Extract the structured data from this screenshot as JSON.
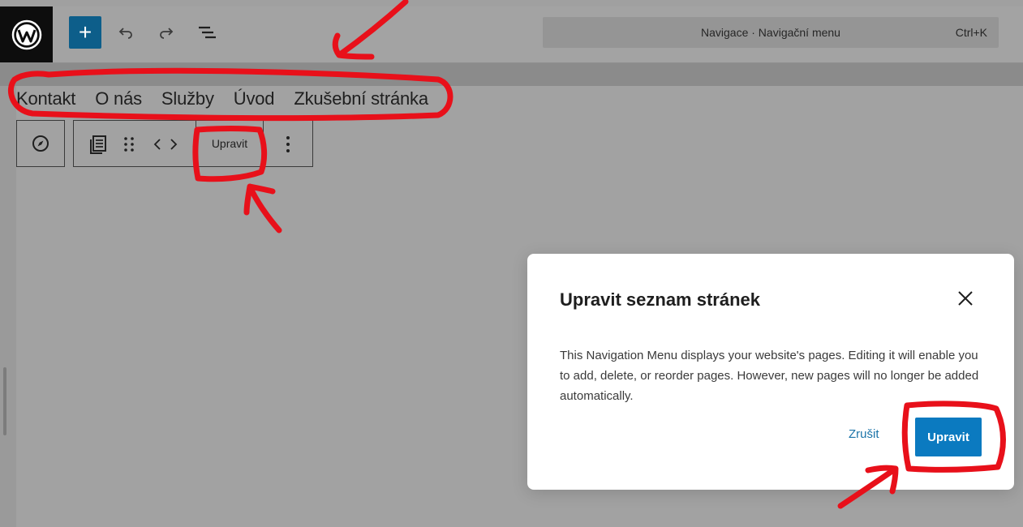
{
  "toolbar": {
    "add_label": "+",
    "command_title": "Navigace · Navigační menu",
    "shortcut": "Ctrl+K"
  },
  "navigation": {
    "items": [
      {
        "label": "Kontakt"
      },
      {
        "label": "O nás"
      },
      {
        "label": "Služby"
      },
      {
        "label": "Úvod"
      },
      {
        "label": "Zkušební stránka"
      }
    ]
  },
  "block_toolbar": {
    "edit_label": "Upravit"
  },
  "modal": {
    "title": "Upravit seznam stránek",
    "body": "This Navigation Menu displays your website's pages. Editing it will enable you to add, delete, or reorder pages. However, new pages will no longer be added automatically.",
    "cancel_label": "Zrušit",
    "confirm_label": "Upravit"
  },
  "colors": {
    "primary": "#0b7ac0",
    "annotation": "#e8101a",
    "overlay_gray": "#a0a0a0"
  },
  "icons": [
    "wordpress-logo-icon",
    "undo-icon",
    "redo-icon",
    "list-view-icon",
    "compass-icon",
    "page-list-icon",
    "drag-handle-icon",
    "chevron-arrows-icon",
    "more-vertical-icon",
    "close-icon"
  ]
}
